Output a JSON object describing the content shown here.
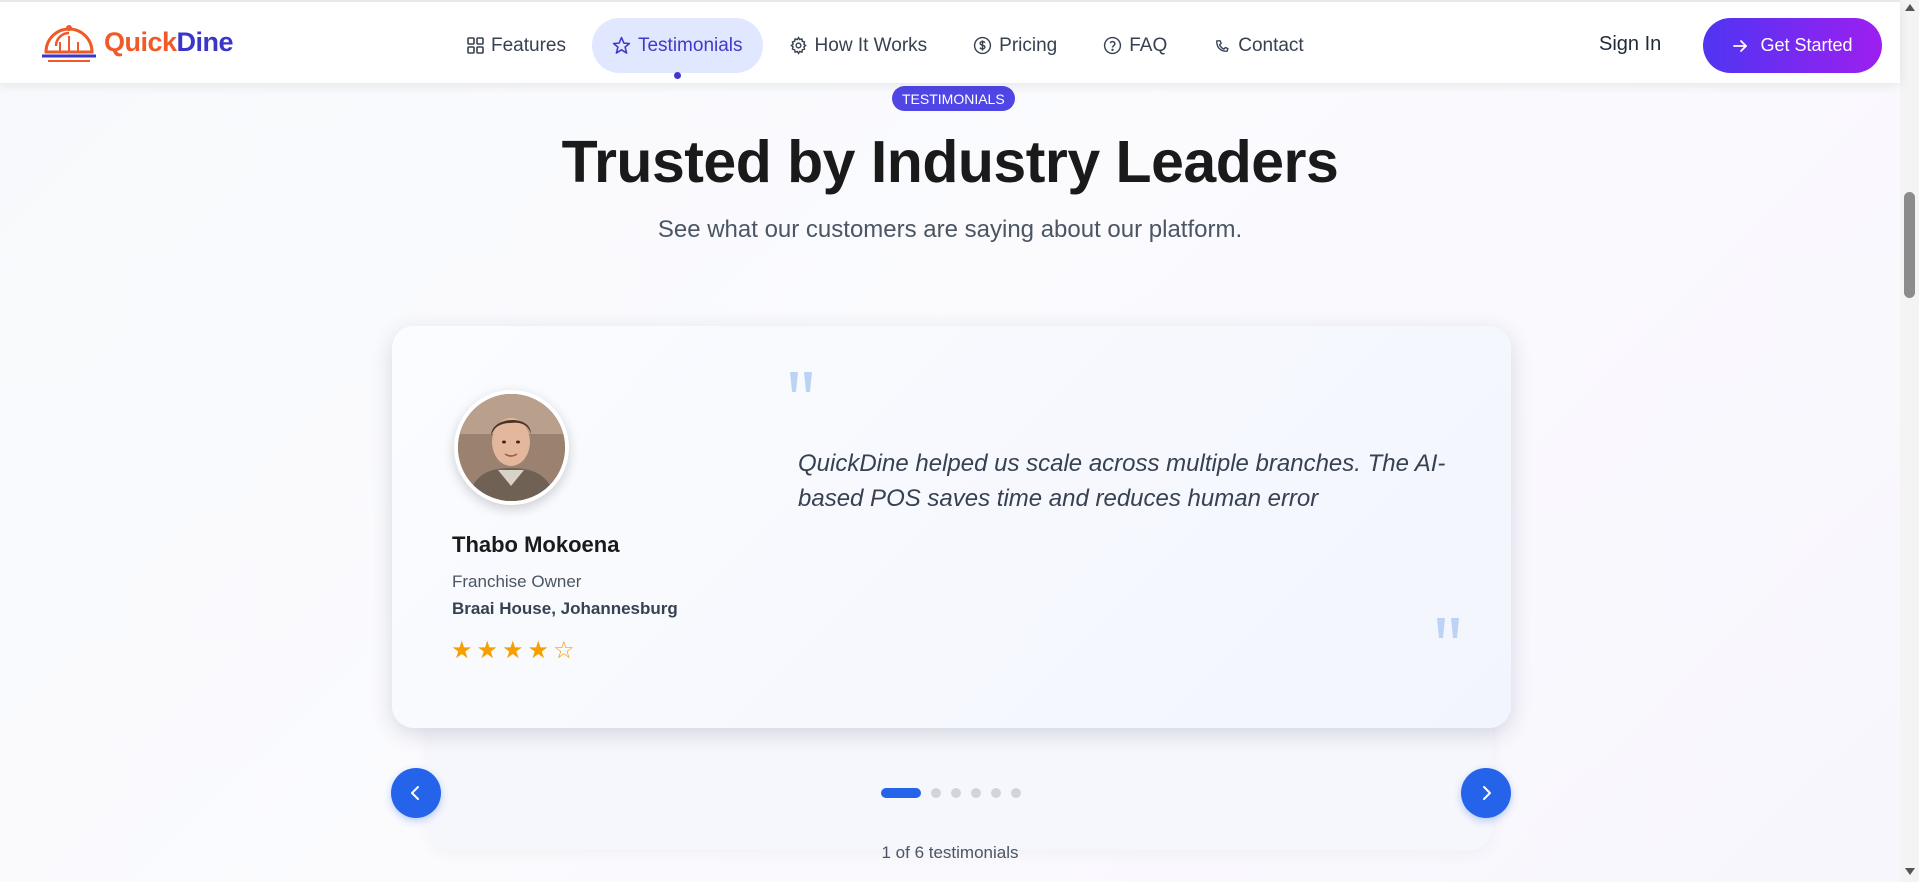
{
  "brand": {
    "quick": "Quick",
    "dine": "Dine",
    "primary_color": "#f05a28",
    "secondary_color": "#3b35c9"
  },
  "nav": {
    "items": [
      {
        "label": "Features",
        "icon": "grid-icon"
      },
      {
        "label": "Testimonials",
        "icon": "star-icon",
        "active": true
      },
      {
        "label": "How It Works",
        "icon": "gear-icon"
      },
      {
        "label": "Pricing",
        "icon": "dollar-circle-icon"
      },
      {
        "label": "FAQ",
        "icon": "question-circle-icon"
      },
      {
        "label": "Contact",
        "icon": "phone-icon"
      }
    ],
    "signin_label": "Sign In",
    "cta_label": "Get Started"
  },
  "section": {
    "badge": "TESTIMONIALS",
    "title": "Trusted by Industry Leaders",
    "subtitle": "See what our customers are saying about our platform."
  },
  "testimonial": {
    "name": "Thabo Mokoena",
    "role": "Franchise Owner",
    "company": "Braai House, Johannesburg",
    "rating": 4,
    "rating_max": 5,
    "quote": "QuickDine helped us scale across multiple branches. The AI-based POS saves time and reduces human error"
  },
  "carousel": {
    "current": 1,
    "total": 6,
    "counter_text": "1 of 6 testimonials"
  },
  "colors": {
    "accent": "#2563eb",
    "star": "#f5a000",
    "badge": "#4f46e5"
  }
}
